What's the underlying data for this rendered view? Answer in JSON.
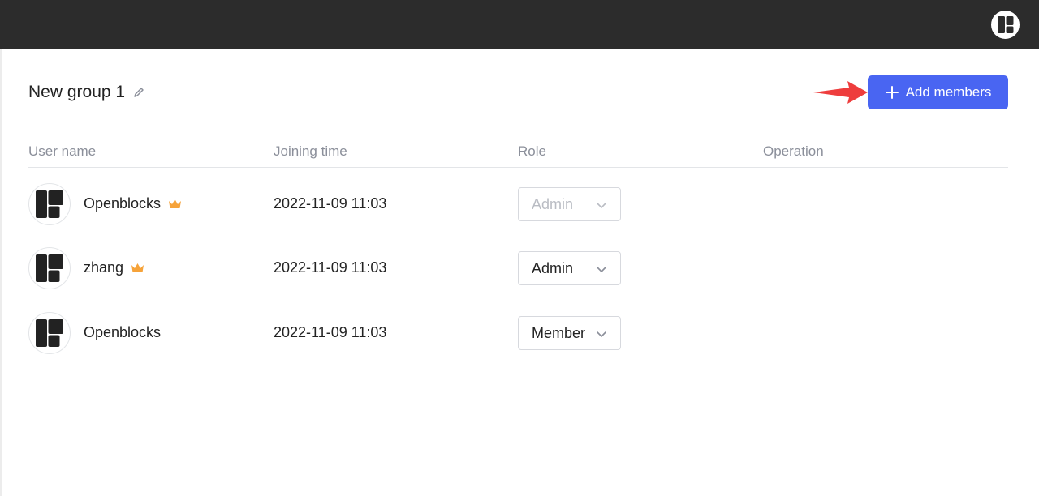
{
  "group": {
    "title": "New group 1"
  },
  "toolbar": {
    "add_members_label": "Add members"
  },
  "table": {
    "columns": [
      "User name",
      "Joining time",
      "Role",
      "Operation"
    ],
    "rows": [
      {
        "name": "Openblocks",
        "owner": true,
        "joined": "2022-11-09 11:03",
        "role": "Admin",
        "role_disabled": true
      },
      {
        "name": "zhang",
        "owner": true,
        "joined": "2022-11-09 11:03",
        "role": "Admin",
        "role_disabled": false
      },
      {
        "name": "Openblocks",
        "owner": false,
        "joined": "2022-11-09 11:03",
        "role": "Member",
        "role_disabled": false
      }
    ]
  },
  "colors": {
    "topbar": "#2c2c2c",
    "accent": "#4965f2",
    "crown": "#f6a33a",
    "annotation_arrow": "#ee3d3d"
  },
  "icons": [
    "app-logo-icon",
    "edit-icon",
    "plus-icon",
    "crown-icon",
    "chevron-down-icon"
  ]
}
